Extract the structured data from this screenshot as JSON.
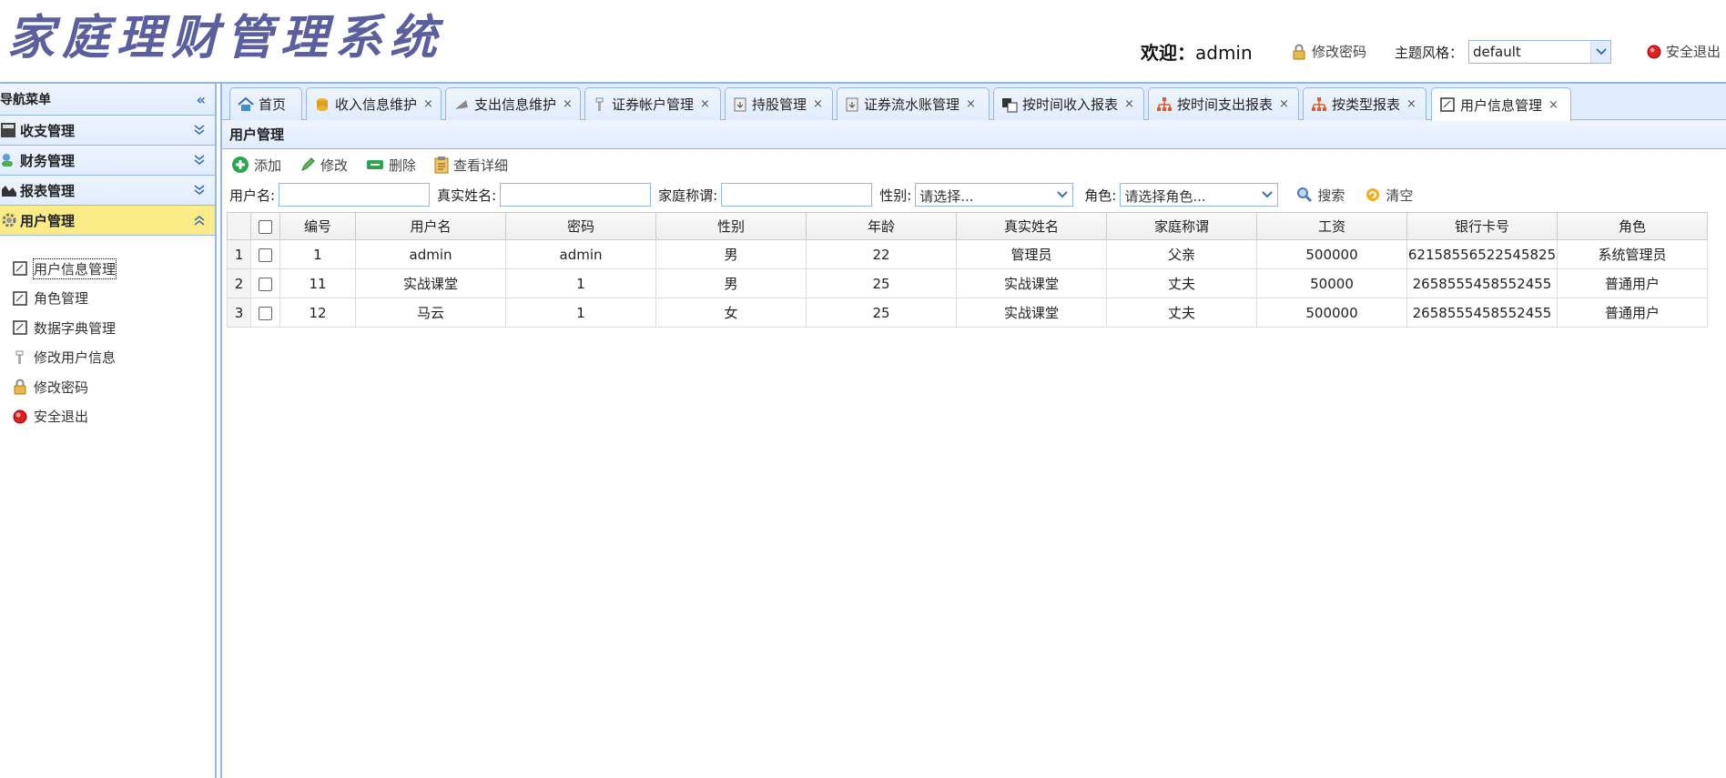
{
  "header": {
    "app_title": "家庭理财管理系统",
    "welcome_label": "欢迎：",
    "username": "admin",
    "change_password_label": "修改密码",
    "theme_label": "主题风格：",
    "theme_value": "default",
    "logout_label": "安全退出"
  },
  "sidebar": {
    "title": "导航菜单",
    "sections": [
      {
        "label": "收支管理"
      },
      {
        "label": "财务管理"
      },
      {
        "label": "报表管理"
      },
      {
        "label": "用户管理"
      }
    ],
    "items": [
      {
        "label": "用户信息管理",
        "icon": "form-icon"
      },
      {
        "label": "角色管理",
        "icon": "form-icon"
      },
      {
        "label": "数据字典管理",
        "icon": "form-icon"
      },
      {
        "label": "修改用户信息",
        "icon": "tool-icon"
      },
      {
        "label": "修改密码",
        "icon": "lock-icon"
      },
      {
        "label": "安全退出",
        "icon": "exit-icon"
      }
    ]
  },
  "tabs": [
    {
      "label": "首页",
      "icon": "home-icon"
    },
    {
      "label": "收入信息维护",
      "icon": "coins-icon"
    },
    {
      "label": "支出信息维护",
      "icon": "cart-icon"
    },
    {
      "label": "证券帐户管理",
      "icon": "tool-icon"
    },
    {
      "label": "持股管理",
      "icon": "doc-icon"
    },
    {
      "label": "证券流水账管理",
      "icon": "doc-icon"
    },
    {
      "label": "按时间收入报表",
      "icon": "report-icon"
    },
    {
      "label": "按时间支出报表",
      "icon": "tree-icon"
    },
    {
      "label": "按类型报表",
      "icon": "tree-icon"
    },
    {
      "label": "用户信息管理",
      "icon": "form-icon"
    }
  ],
  "tab_close": "×",
  "panel": {
    "title": "用户管理",
    "toolbar": {
      "add": "添加",
      "edit": "修改",
      "delete": "删除",
      "detail": "查看详细"
    },
    "search": {
      "username_label": "用户名:",
      "realname_label": "真实姓名:",
      "family_label": "家庭称谓:",
      "gender_label": "性别:",
      "gender_value": "请选择...",
      "role_label": "角色:",
      "role_value": "请选择角色...",
      "search_button": "搜索",
      "clear_button": "清空"
    }
  },
  "grid": {
    "columns": [
      "编号",
      "用户名",
      "密码",
      "性别",
      "年龄",
      "真实姓名",
      "家庭称谓",
      "工资",
      "银行卡号",
      "角色"
    ],
    "rows": [
      {
        "num": "1",
        "cells": [
          "1",
          "admin",
          "admin",
          "男",
          "22",
          "管理员",
          "父亲",
          "500000",
          "62158556522545825",
          "系统管理员"
        ]
      },
      {
        "num": "2",
        "cells": [
          "11",
          "实战课堂",
          "1",
          "男",
          "25",
          "实战课堂",
          "丈夫",
          "50000",
          "2658555458552455",
          "普通用户"
        ]
      },
      {
        "num": "3",
        "cells": [
          "12",
          "马云",
          "1",
          "女",
          "25",
          "实战课堂",
          "丈夫",
          "500000",
          "2658555458552455",
          "普通用户"
        ]
      }
    ]
  },
  "colors": {
    "border": "#95b8e7",
    "header_bg": "#e0ecff",
    "active_section": "#fbec88",
    "title": "#5b5f9e"
  }
}
